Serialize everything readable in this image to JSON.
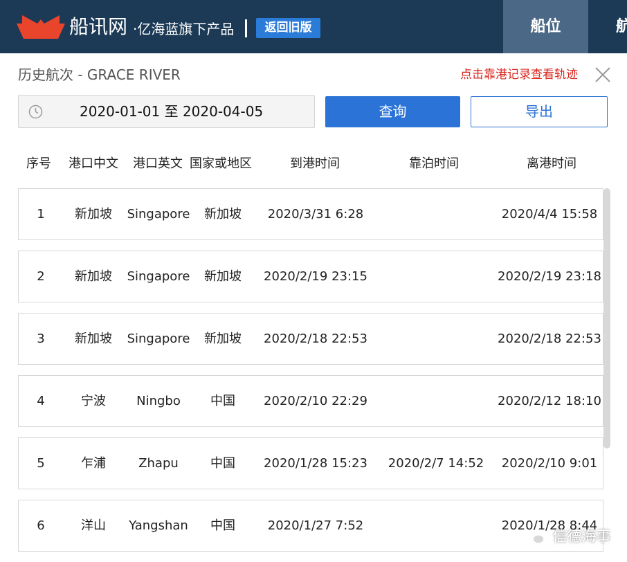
{
  "header": {
    "brand": "船讯网",
    "sub": "·亿海蓝旗下产品",
    "old_version_label": "返回旧版",
    "nav_active": "船位",
    "nav_next": "航"
  },
  "page": {
    "title": "历史航次 - GRACE RIVER",
    "hint": "点击靠港记录查看轨迹"
  },
  "controls": {
    "date_range": "2020-01-01 至 2020-04-05",
    "query_label": "查询",
    "export_label": "导出"
  },
  "table": {
    "headers": [
      "序号",
      "港口中文",
      "港口英文",
      "国家或地区",
      "到港时间",
      "靠泊时间",
      "离港时间"
    ],
    "rows": [
      [
        "1",
        "新加坡",
        "Singapore",
        "新加坡",
        "2020/3/31 6:28",
        "",
        "2020/4/4 15:58"
      ],
      [
        "2",
        "新加坡",
        "Singapore",
        "新加坡",
        "2020/2/19 23:15",
        "",
        "2020/2/19 23:18"
      ],
      [
        "3",
        "新加坡",
        "Singapore",
        "新加坡",
        "2020/2/18 22:53",
        "",
        "2020/2/18 22:53"
      ],
      [
        "4",
        "宁波",
        "Ningbo",
        "中国",
        "2020/2/10 22:29",
        "",
        "2020/2/12 18:10"
      ],
      [
        "5",
        "乍浦",
        "Zhapu",
        "中国",
        "2020/1/28 15:23",
        "2020/2/7 14:52",
        "2020/2/10 9:01"
      ],
      [
        "6",
        "洋山",
        "Yangshan",
        "中国",
        "2020/1/27 7:52",
        "",
        "2020/1/28 8:44"
      ]
    ]
  },
  "watermark": {
    "text": "信德海事",
    "icon": "wechat-icon"
  },
  "colors": {
    "header_bg": "#1c3a56",
    "nav_active_bg": "#4b6886",
    "accent_blue": "#2b73d6",
    "hint_red": "#d9251d",
    "logo_red": "#e8452c"
  }
}
